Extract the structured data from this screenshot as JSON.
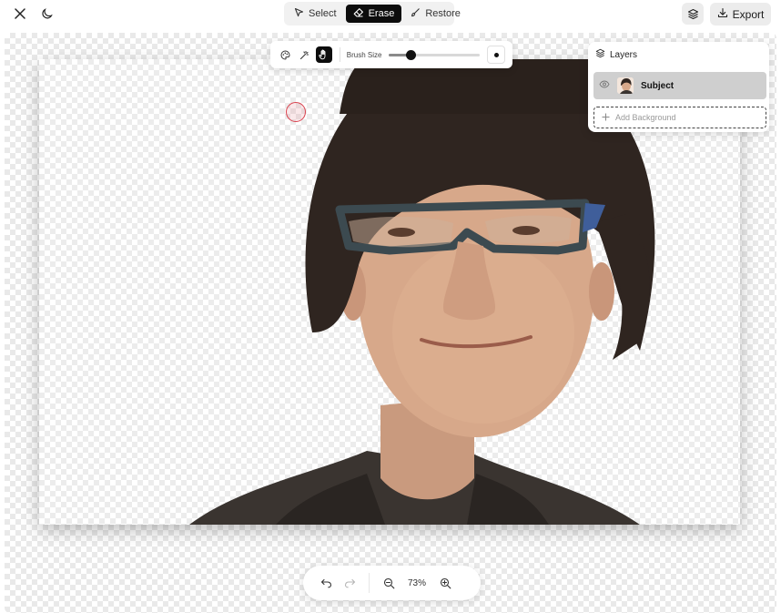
{
  "toolbar_top": {
    "modes": [
      {
        "label": "Select",
        "icon": "cursor-arrow-icon",
        "active": false
      },
      {
        "label": "Erase",
        "icon": "eraser-icon",
        "active": true
      },
      {
        "label": "Restore",
        "icon": "brush-icon",
        "active": false
      }
    ],
    "export_label": "Export"
  },
  "brush_toolbar": {
    "tools": [
      "palette-icon",
      "magic-wand-icon",
      "hand-icon"
    ],
    "active_tool": "hand-icon",
    "brush_size_label": "Brush Size",
    "brush_size_fraction": 0.24
  },
  "layers": {
    "title": "Layers",
    "items": [
      {
        "name": "Subject",
        "visible": true
      }
    ],
    "add_background_label": "Add Background"
  },
  "zoom": {
    "level": "73%"
  },
  "colors": {
    "active_bg": "#0d0d0d",
    "brush_cursor": "#d9434f",
    "layer_selected": "#cfcfcf"
  }
}
